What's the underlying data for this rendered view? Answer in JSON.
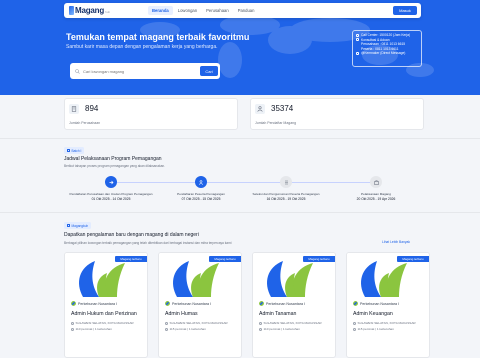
{
  "navbar": {
    "logo_text": "Magang",
    "logo_sub": "hub",
    "links": [
      "Beranda",
      "Lowongan",
      "Perusahaan",
      "Panduan"
    ],
    "active_link": "Beranda",
    "login_label": "Masuk"
  },
  "hero": {
    "title": "Temukan tempat magang terbaik favoritmu",
    "subtitle": "Sambut karir masa depan dengan pengalaman kerja yang berharga.",
    "search_placeholder": "Cari lowongan magang",
    "search_button": "Cari",
    "contact": [
      "Call Center: 1500120 (Jam Kerja)",
      "Konsultasi & Aduan",
      "Perusahaan : 0811 1013 6615",
      "Peserta : 0811 1013 6611",
      "@Kemnaker (Direct Message)"
    ]
  },
  "stats": [
    {
      "value": "894",
      "label": "Jumlah Perusahaan",
      "icon": "building-icon"
    },
    {
      "value": "35374",
      "label": "Jumlah Pendaftar Magang",
      "icon": "people-icon"
    }
  ],
  "schedule": {
    "badge": "Batch I",
    "title": "Jadwal Pelaksanaan Program Pemagangan",
    "subtitle": "Berikut tahapan proses program pemagangan yang akan dilaksanakan.",
    "steps": [
      {
        "label": "Pendaftaran Perusahaan dan Usulan Program Pemagangan",
        "date": "01 Okt 2025 - 14 Okt 2025",
        "active": true
      },
      {
        "label": "Pendaftaran Peserta Pemagangan",
        "date": "07 Okt 2025 - 15 Okt 2025",
        "active": true
      },
      {
        "label": "Seleksi dan Pengumuman Peserta Pemagangan",
        "date": "16 Okt 2025 - 19 Okt 2025",
        "active": false
      },
      {
        "label": "Pelaksanaan Magang",
        "date": "20 Okt 2025 - 19 Apr 2026",
        "active": false
      }
    ]
  },
  "opportunities": {
    "badge": "Magangkuh",
    "title": "Dapatkan pengalaman baru dengan magang di dalam negeri",
    "subtitle": "Berbagai pilihan lowongan terbaik pemagangan yang telah diterbitkan dari berbagai instansi dan mitra terpercaya kami",
    "see_all": "Lihat Lebih Banyak",
    "cards": [
      {
        "ribbon": "Magang terbaru",
        "company": "Perkebunan Nusantara I",
        "title": "Admin Hukum dan Perizinan",
        "location": "SULAWESI SELATAN, KOTA MAKASSAR",
        "quota": "110 peminat | 1 kebutuhan"
      },
      {
        "ribbon": "Magang terbaru",
        "company": "Perkebunan Nusantara I",
        "title": "Admin Humas",
        "location": "SULAWESI SELATAN, KOTA MAKASSAR",
        "quota": "115 peminat | 1 kebutuhan"
      },
      {
        "ribbon": "Magang terbaru",
        "company": "Perkebunan Nusantara I",
        "title": "Admin Tanaman",
        "location": "SULAWESI SELATAN, KOTA MAKASSAR",
        "quota": "110 peminat | 1 kebutuhan"
      },
      {
        "ribbon": "Magang terbaru",
        "company": "Perkebunan Nusantara I",
        "title": "Admin Keuangan",
        "location": "SULAWESI SELATAN, KOTA MAKASSAR",
        "quota": "115 peminat | 1 kebutuhan"
      }
    ]
  },
  "colors": {
    "primary": "#1f63e8",
    "leaf_blue": "#1f63e8",
    "leaf_green": "#8bc53f"
  }
}
